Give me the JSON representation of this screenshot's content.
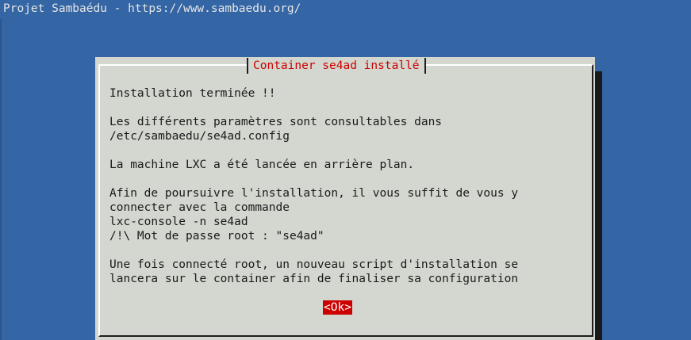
{
  "backtitle": "Projet Sambaédu - https://www.sambaedu.org/",
  "dialog": {
    "title": "Container se4ad installé",
    "lines": [
      "Installation terminée !!",
      "",
      "Les différents paramètres sont consultables dans",
      "/etc/sambaedu/se4ad.config",
      "",
      "La machine LXC a été lancée en arrière plan.",
      "",
      "Afin de poursuivre l'installation, il vous suffit de vous y",
      "connecter avec la commande",
      "lxc-console -n se4ad",
      "/!\\ Mot de passe root : \"se4ad\"",
      "",
      "Une fois connecté root, un nouveau script d'installation se",
      "lancera sur le container afin de finaliser sa configuration"
    ],
    "ok_label": "<Ok>"
  },
  "colors": {
    "background": "#3465a4",
    "dialog": "#d3d7cf",
    "accent": "#cc0000"
  }
}
